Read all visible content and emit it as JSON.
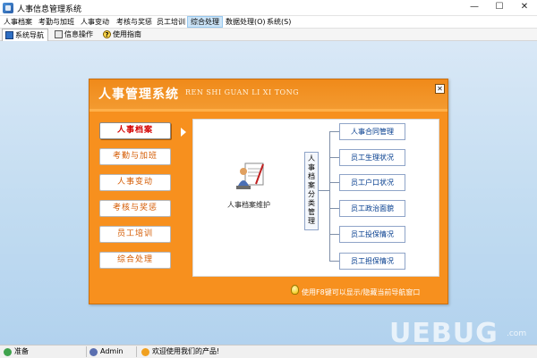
{
  "window": {
    "title": "人事信息管理系统",
    "controls": [
      "—",
      "☐",
      "✕"
    ]
  },
  "menu": {
    "items": [
      {
        "label": "人事档案"
      },
      {
        "label": "考勤与加班"
      },
      {
        "label": "人事变动"
      },
      {
        "label": "考核与奖惩"
      },
      {
        "label": "员工培训"
      },
      {
        "label": "综合处理"
      },
      {
        "label": "数据处理(O)"
      },
      {
        "label": "系统(S)"
      }
    ],
    "active": "综合处理"
  },
  "toolbar": {
    "items": [
      {
        "label": "系统导航",
        "icon": "monitor-icon"
      },
      {
        "label": "信息操作",
        "icon": "document-icon"
      },
      {
        "label": "使用指南",
        "icon": "help-icon"
      }
    ]
  },
  "dialog": {
    "title": "人事管理系统",
    "subtitle": "REN SHI GUAN LI XI TONG",
    "close": "✕",
    "nav": [
      {
        "label": "人事档案",
        "active": true
      },
      {
        "label": "考勤与加班"
      },
      {
        "label": "人事变动"
      },
      {
        "label": "考核与奖惩"
      },
      {
        "label": "员工培训"
      },
      {
        "label": "综合处理"
      }
    ],
    "content": {
      "doc_label": "人事档案维护",
      "center_label": "人事档案分类管理",
      "right_buttons": [
        "人事合同管理",
        "员工生理状况",
        "员工户口状况",
        "员工政治面貌",
        "员工投保情况",
        "员工担保情况"
      ]
    },
    "hint": "使用F8键可以显示/隐藏当前导航窗口"
  },
  "statusbar": {
    "ready": "准备",
    "user": "Admin",
    "welcome": "欢迎使用我们的产品!"
  },
  "watermark": {
    "text": "UEBUG",
    "sub": ".com"
  }
}
